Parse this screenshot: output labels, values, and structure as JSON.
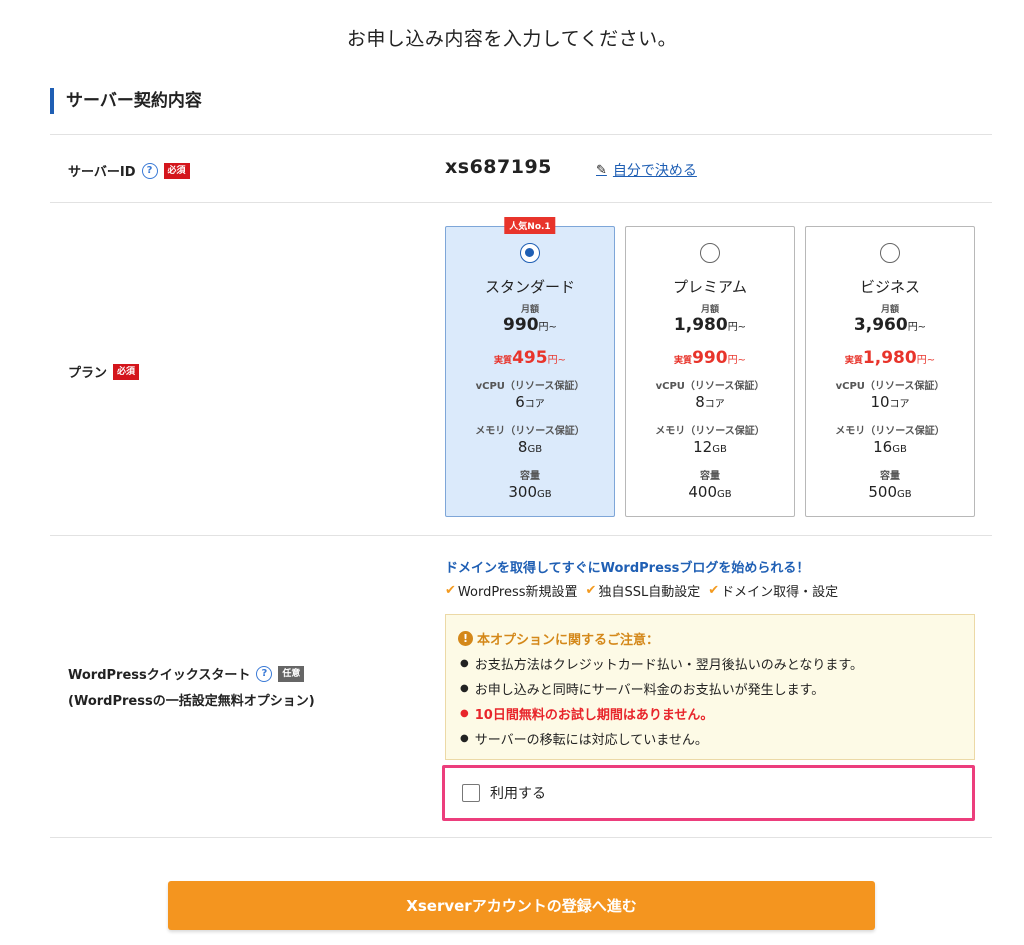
{
  "page_heading": "お申し込み内容を入力してください。",
  "section_title": "サーバー契約内容",
  "colors": {
    "accent_blue": "#1f5fb4",
    "required_red": "#d4151c",
    "sale_red": "#e8342b",
    "submit_orange": "#f4951f",
    "highlight_pink": "#ec3e7c"
  },
  "server_id": {
    "label": "サーバーID",
    "help_icon": "question-circle-icon",
    "help_glyph": "?",
    "required_badge": "必須",
    "value": "xs687195",
    "custom_link_icon": "pencil-icon",
    "custom_link_glyph": "✎",
    "custom_link": "自分で決める"
  },
  "plan": {
    "label": "プラン",
    "required_badge": "必須",
    "popular_badge": "人気No.1",
    "monthly_label": "月額",
    "price_unit": "円~",
    "effective_label": "実質",
    "vcpu_label": "vCPU（リソース保証）",
    "memory_label": "メモリ（リソース保証）",
    "storage_label": "容量",
    "core_unit": "コア",
    "gb_unit": "GB",
    "options": [
      {
        "name": "スタンダード",
        "price": "990",
        "effective_price": "495",
        "vcpu": "6",
        "memory": "8",
        "storage": "300",
        "selected": true
      },
      {
        "name": "プレミアム",
        "price": "1,980",
        "effective_price": "990",
        "vcpu": "8",
        "memory": "12",
        "storage": "400",
        "selected": false
      },
      {
        "name": "ビジネス",
        "price": "3,960",
        "effective_price": "1,980",
        "vcpu": "10",
        "memory": "16",
        "storage": "500",
        "selected": false
      }
    ]
  },
  "wordpress": {
    "label_line1": "WordPressクイックスタート",
    "label_line2": "(WordPressの一括設定無料オプション)",
    "help_glyph": "?",
    "optional_badge": "任意",
    "promo": "ドメインを取得してすぐにWordPressブログを始められる！",
    "check_glyph": "✔",
    "features": [
      "WordPress新規設置",
      "独自SSL自動設定",
      "ドメイン取得・設定"
    ],
    "notice_icon_glyph": "!",
    "notice_title": "本オプションに関するご注意：",
    "notices": [
      {
        "text": "お支払方法はクレジットカード払い・翌月後払いのみとなります。",
        "emphasis": false
      },
      {
        "text": "お申し込みと同時にサーバー料金のお支払いが発生します。",
        "emphasis": false
      },
      {
        "text": "10日間無料のお試し期間はありません。",
        "emphasis": true
      },
      {
        "text": "サーバーの移転には対応していません。",
        "emphasis": false
      }
    ],
    "use_label": "利用する",
    "use_checked": false
  },
  "submit_button": "Xserverアカウントの登録へ進む"
}
